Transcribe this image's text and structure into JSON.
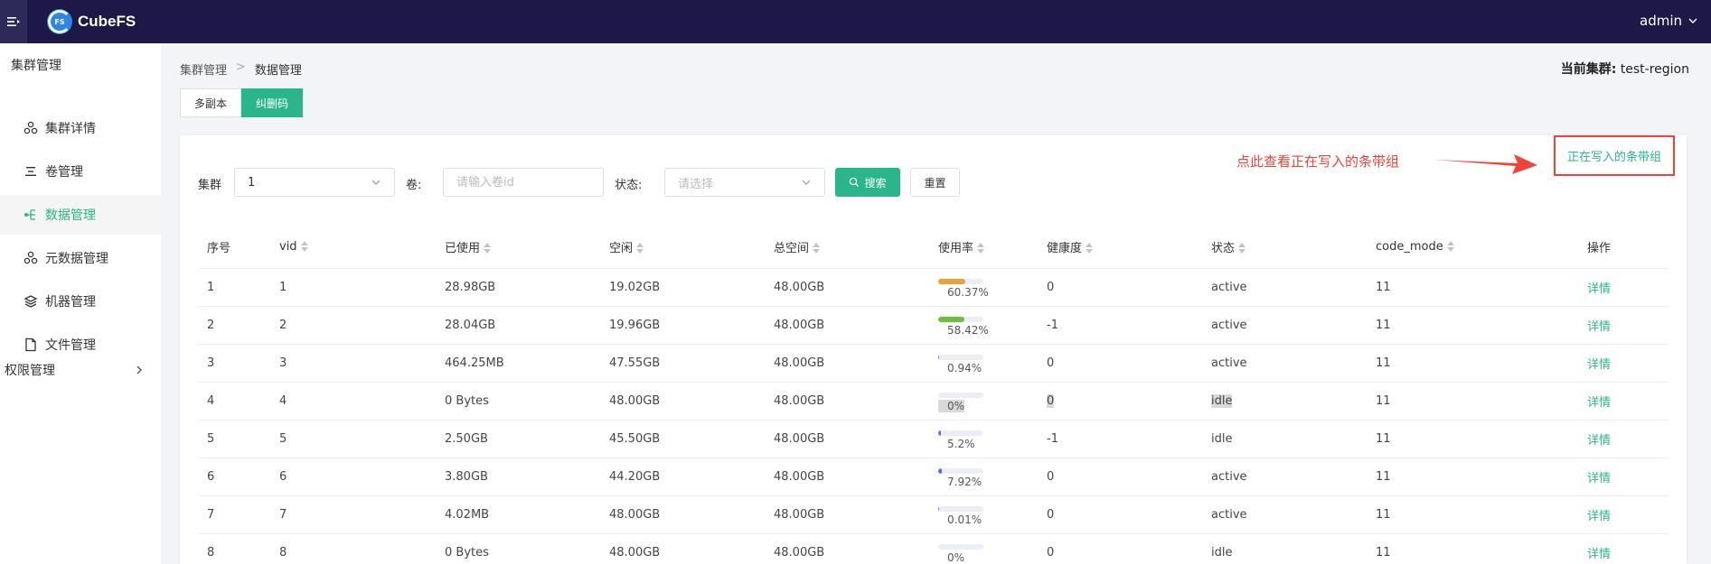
{
  "header": {
    "brand": "CubeFS",
    "user": "admin"
  },
  "sidebar": {
    "group_label": "集群管理",
    "items": [
      {
        "label": "集群详情",
        "icon": "cluster-icon"
      },
      {
        "label": "卷管理",
        "icon": "list-icon"
      },
      {
        "label": "数据管理",
        "icon": "tree-icon",
        "active": true
      },
      {
        "label": "元数据管理",
        "icon": "cluster-icon"
      },
      {
        "label": "机器管理",
        "icon": "layers-icon"
      },
      {
        "label": "文件管理",
        "icon": "file-icon"
      }
    ],
    "group2_label": "权限管理"
  },
  "breadcrumb": {
    "parent": "集群管理",
    "sep": ">",
    "current": "数据管理"
  },
  "cluster_info": {
    "label": "当前集群:",
    "value": "test-region"
  },
  "tabs": [
    {
      "label": "多副本"
    },
    {
      "label": "纠删码",
      "active": true
    }
  ],
  "filters": {
    "cluster_label": "集群",
    "cluster_value": "1",
    "vol_label": "卷:",
    "vol_placeholder": "请输入卷id",
    "status_label": "状态:",
    "status_placeholder": "请选择",
    "search_label": "搜索",
    "reset_label": "重置"
  },
  "annotation": {
    "text": "点此查看正在写入的条带组",
    "color": "#f0443a"
  },
  "writing_link": "正在写入的条带组",
  "colors": {
    "accent": "#2ab58a",
    "topbar": "#1d1845",
    "orange": "#e6a23c",
    "green": "#67c23a",
    "blue": "#5b6ee8"
  },
  "table": {
    "columns": [
      "序号",
      "vid",
      "已使用",
      "空闲",
      "总空间",
      "使用率",
      "健康度",
      "状态",
      "code_mode",
      "操作"
    ],
    "rows": [
      {
        "idx": "1",
        "vid": "1",
        "used": "28.98GB",
        "free": "19.02GB",
        "total": "48.00GB",
        "usage": 60.37,
        "usage_label": "60.37%",
        "health": "0",
        "status": "active",
        "code_mode": "11",
        "action": "详情"
      },
      {
        "idx": "2",
        "vid": "2",
        "used": "28.04GB",
        "free": "19.96GB",
        "total": "48.00GB",
        "usage": 58.42,
        "usage_label": "58.42%",
        "health": "-1",
        "status": "active",
        "code_mode": "11",
        "action": "详情"
      },
      {
        "idx": "3",
        "vid": "3",
        "used": "464.25MB",
        "free": "47.55GB",
        "total": "48.00GB",
        "usage": 0.94,
        "usage_label": "0.94%",
        "health": "0",
        "status": "active",
        "code_mode": "11",
        "action": "详情"
      },
      {
        "idx": "4",
        "vid": "4",
        "used": "0 Bytes",
        "free": "48.00GB",
        "total": "48.00GB",
        "usage": 0,
        "usage_label": "0%",
        "health": "0",
        "status": "idle",
        "code_mode": "11",
        "action": "详情"
      },
      {
        "idx": "5",
        "vid": "5",
        "used": "2.50GB",
        "free": "45.50GB",
        "total": "48.00GB",
        "usage": 5.2,
        "usage_label": "5.2%",
        "health": "-1",
        "status": "idle",
        "code_mode": "11",
        "action": "详情"
      },
      {
        "idx": "6",
        "vid": "6",
        "used": "3.80GB",
        "free": "44.20GB",
        "total": "48.00GB",
        "usage": 7.92,
        "usage_label": "7.92%",
        "health": "0",
        "status": "active",
        "code_mode": "11",
        "action": "详情"
      },
      {
        "idx": "7",
        "vid": "7",
        "used": "4.02MB",
        "free": "48.00GB",
        "total": "48.00GB",
        "usage": 0.01,
        "usage_label": "0.01%",
        "health": "0",
        "status": "active",
        "code_mode": "11",
        "action": "详情"
      },
      {
        "idx": "8",
        "vid": "8",
        "used": "0 Bytes",
        "free": "48.00GB",
        "total": "48.00GB",
        "usage": 0,
        "usage_label": "0%",
        "health": "0",
        "status": "idle",
        "code_mode": "11",
        "action": "详情"
      }
    ]
  }
}
